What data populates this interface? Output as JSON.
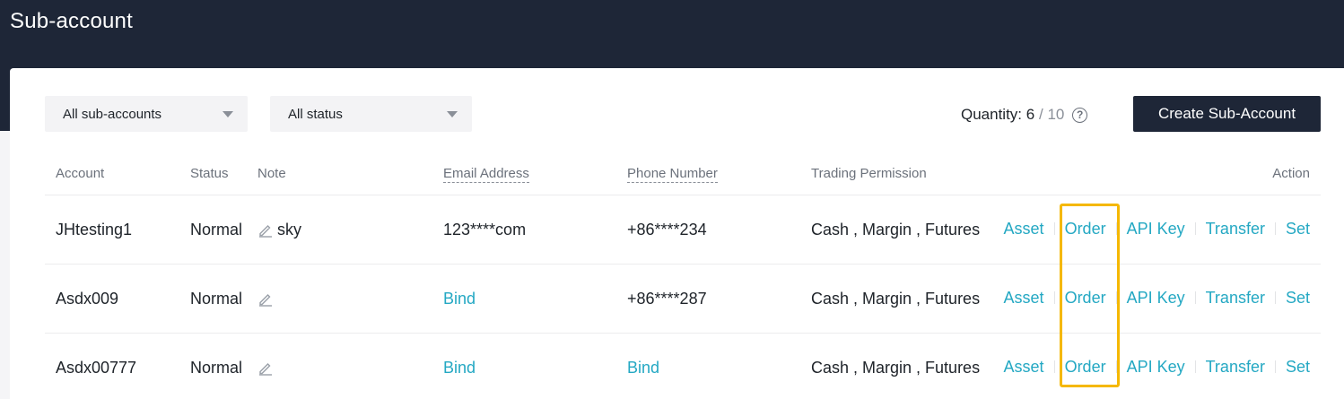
{
  "page": {
    "title": "Sub-account"
  },
  "filters": {
    "account_select": "All sub-accounts",
    "status_select": "All status"
  },
  "quantity": {
    "label": "Quantity:",
    "current": "6",
    "separator": "/",
    "max": "10",
    "help_icon": "question-circle-icon"
  },
  "create_button": "Create Sub-Account",
  "table": {
    "headers": {
      "account": "Account",
      "status": "Status",
      "note": "Note",
      "email": "Email Address",
      "phone": "Phone Number",
      "trading": "Trading Permission",
      "action": "Action"
    },
    "rows": [
      {
        "account": "JHtesting1",
        "status": "Normal",
        "note": "sky",
        "email": "123****com",
        "phone": "+86****234",
        "trading": "Cash , Margin , Futures"
      },
      {
        "account": "Asdx009",
        "status": "Normal",
        "note": "",
        "email": "Bind",
        "phone": "+86****287",
        "trading": "Cash , Margin , Futures"
      },
      {
        "account": "Asdx00777",
        "status": "Normal",
        "note": "",
        "email": "Bind",
        "phone": "Bind",
        "trading": "Cash , Margin , Futures"
      }
    ],
    "actions": {
      "asset": "Asset",
      "order": "Order",
      "api_key": "API Key",
      "transfer": "Transfer",
      "set": "Set"
    }
  },
  "colors": {
    "header_bg": "#1e2637",
    "link": "#24a8c3",
    "highlight": "#f5b800"
  }
}
